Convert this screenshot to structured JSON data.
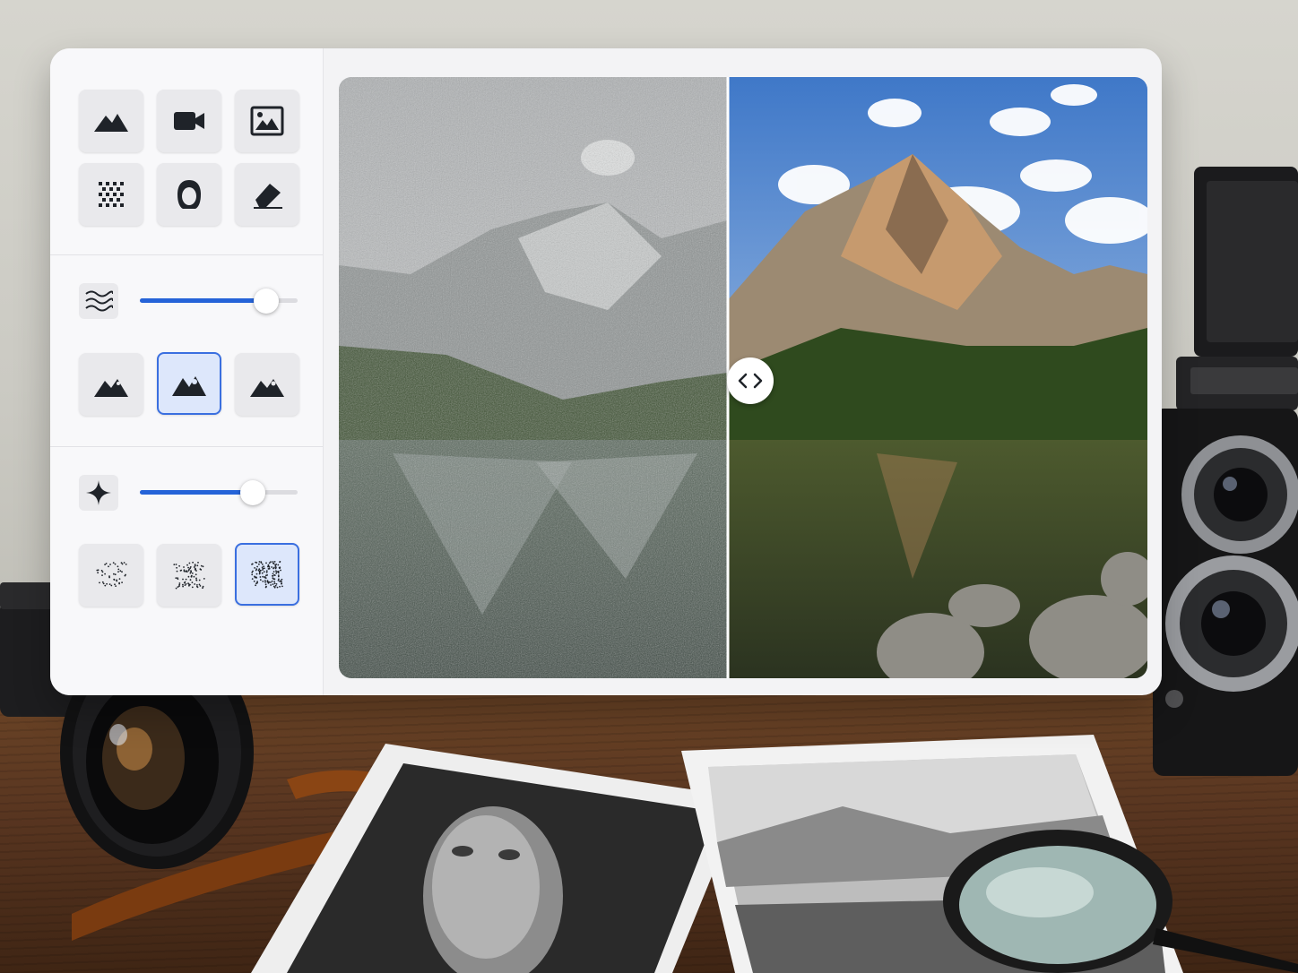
{
  "app": {
    "tools_top": [
      {
        "icon": "mountain-icon"
      },
      {
        "icon": "video-camera-icon"
      },
      {
        "icon": "picture-frame-icon"
      },
      {
        "icon": "noise-grid-icon"
      },
      {
        "icon": "face-portrait-icon"
      },
      {
        "icon": "eraser-icon"
      }
    ],
    "denoise": {
      "icon": "waves-icon",
      "value": 0.86,
      "presets": [
        "mountain-small-icon",
        "mountain-medium-icon",
        "mountain-large-icon"
      ],
      "selected_preset": 1
    },
    "grain": {
      "icon": "sparkle-icon",
      "value": 0.76,
      "presets": [
        "grain-light-icon",
        "grain-medium-icon",
        "grain-heavy-icon"
      ],
      "selected_preset": 2
    },
    "compare": {
      "split": 0.48,
      "left": "noisy-original",
      "right": "enhanced-result"
    },
    "colors": {
      "accent": "#2563d8",
      "selected_bg": "#dde7fb",
      "icon": "#1f2329"
    }
  }
}
